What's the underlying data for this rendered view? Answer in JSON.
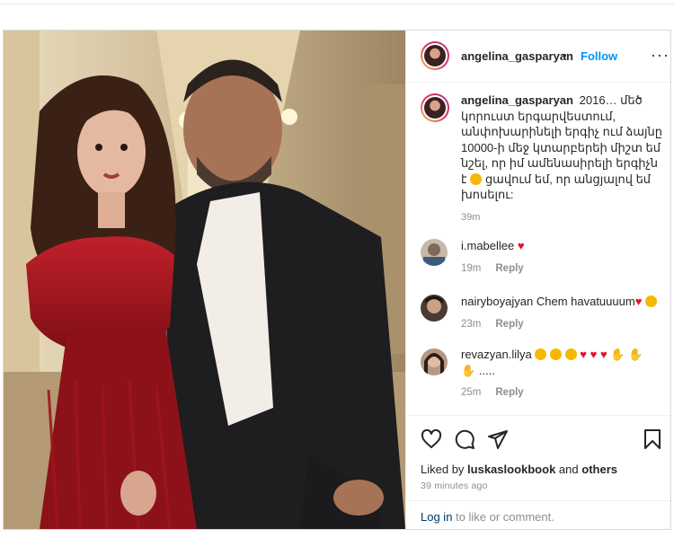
{
  "post": {
    "author": "angelina_gasparyan",
    "dot": "•",
    "follow_label": "Follow",
    "more_label": "···",
    "caption": {
      "username": "angelina_gasparyan",
      "text_1": "2016… մեծ կորուստ երգարվեստում, անփոխարինելի երգիչ ում ձայնը 10000-ի մեջ կտարբերեի միշտ եմ նշել, որ իմ ամենասիրելի երգիչն է",
      "text_2": "ցավում եմ, որ անցյալով եմ խոսելու:",
      "time": "39m"
    }
  },
  "comments": [
    {
      "username": "i.mabellee",
      "text": "",
      "emoji": "♥",
      "time": "19m",
      "reply": "Reply"
    },
    {
      "username": "nairyboyajyan",
      "text": "Chem havatuuuum",
      "emoji": "♥",
      "time": "23m",
      "reply": "Reply"
    },
    {
      "username": "revazyan.lilya",
      "text": "",
      "line2": ".....",
      "time": "25m",
      "reply": "Reply"
    }
  ],
  "likes": {
    "prefix": "Liked by",
    "user": "luskaslookbook",
    "and": "and",
    "others": "others"
  },
  "posted_ago": "39 minutes ago",
  "login": {
    "link": "Log in",
    "rest": "to like or comment."
  },
  "icons": [
    "heart-outline-icon",
    "comment-icon",
    "share-icon",
    "bookmark-icon"
  ],
  "colors": {
    "accent": "#0095f6",
    "text": "#262626",
    "muted": "#8e8e8e",
    "heart": "#e0132c",
    "link": "#00376b"
  }
}
